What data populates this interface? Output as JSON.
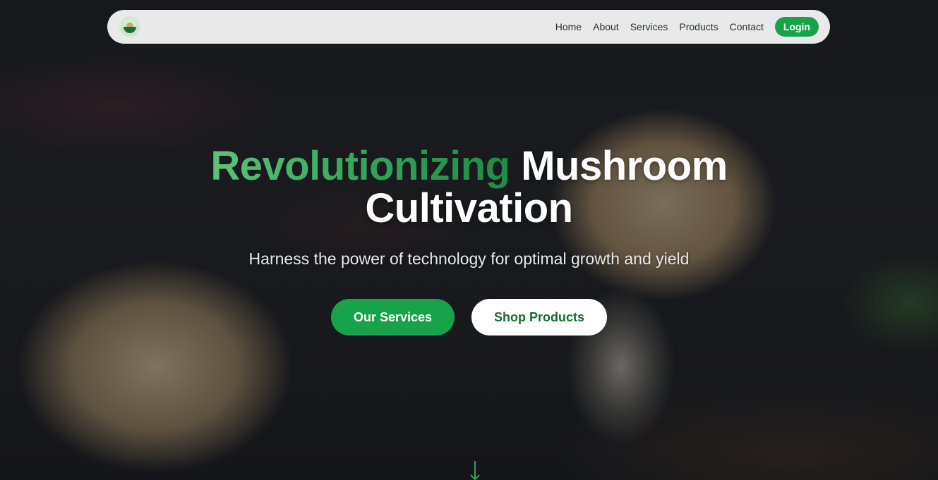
{
  "nav": {
    "logo_icon": "mushroom-farm-logo-icon",
    "links": [
      "Home",
      "About",
      "Services",
      "Products",
      "Contact"
    ],
    "login_label": "Login"
  },
  "hero": {
    "title_accent": "Revolutionizing",
    "title_rest": "Mushroom",
    "title_line2": "Cultivation",
    "subtitle": "Harness the power of technology for optimal growth and yield",
    "primary_button": "Our Services",
    "secondary_button": "Shop Products",
    "scroll_icon": "arrow-down-icon"
  },
  "colors": {
    "brand_green": "#17a34a",
    "accent_gradient_start": "#5fc27a",
    "accent_gradient_end": "#1f8d44",
    "navbar_bg": "#e8e9e8",
    "secondary_button_text": "#176b34"
  }
}
